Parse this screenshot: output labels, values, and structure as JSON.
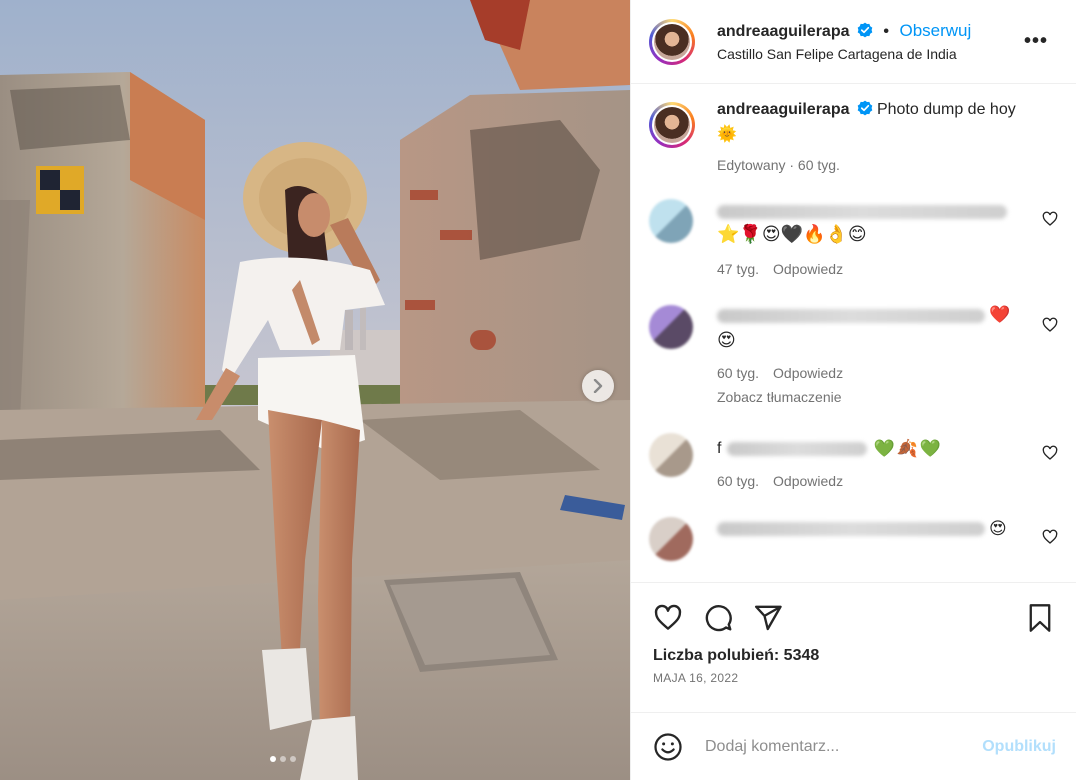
{
  "post": {
    "username": "andreaaguilerapa",
    "follow_label": "Obserwuj",
    "location": "Castillo San Felipe Cartagena de India",
    "more_label": "•••",
    "carousel_pages": 3,
    "carousel_current": 1
  },
  "caption": {
    "username": "andreaaguilerapa",
    "text": "Photo dump de hoy ",
    "emoji": "🌞",
    "edited": "Edytowany · 60 tyg."
  },
  "comments": [
    {
      "emoji_line": "⭐🌹😍🖤🔥👌😊",
      "time": "47 tyg.",
      "reply": "Odpowiedz",
      "trailing_emoji": ""
    },
    {
      "emoji_line": "😍",
      "time": "60 tyg.",
      "reply": "Odpowiedz",
      "translate": "Zobacz tłumaczenie",
      "trailing_emoji": "❤️"
    },
    {
      "prefix": "f",
      "emoji_line": "",
      "time": "60 tyg.",
      "reply": "Odpowiedz",
      "trailing_emoji": "💚🍂💚"
    },
    {
      "emoji_line": "",
      "time": "",
      "reply": "",
      "trailing_emoji": "😍"
    }
  ],
  "actions": {
    "likes": "Liczba polubień: 5348",
    "date": "MAJA 16, 2022"
  },
  "add_comment": {
    "placeholder": "Dodaj komentarz...",
    "publish": "Opublikuj"
  },
  "colors": {
    "accent": "#0095f6",
    "verified": "#0095f6",
    "publish_disabled": "#b2dffc",
    "muted": "#737373"
  },
  "icons": {
    "like": "heart-icon",
    "comment": "comment-icon",
    "share": "paper-plane-icon",
    "save": "bookmark-icon",
    "emoji": "smiley-icon",
    "next": "chevron-right-icon"
  }
}
